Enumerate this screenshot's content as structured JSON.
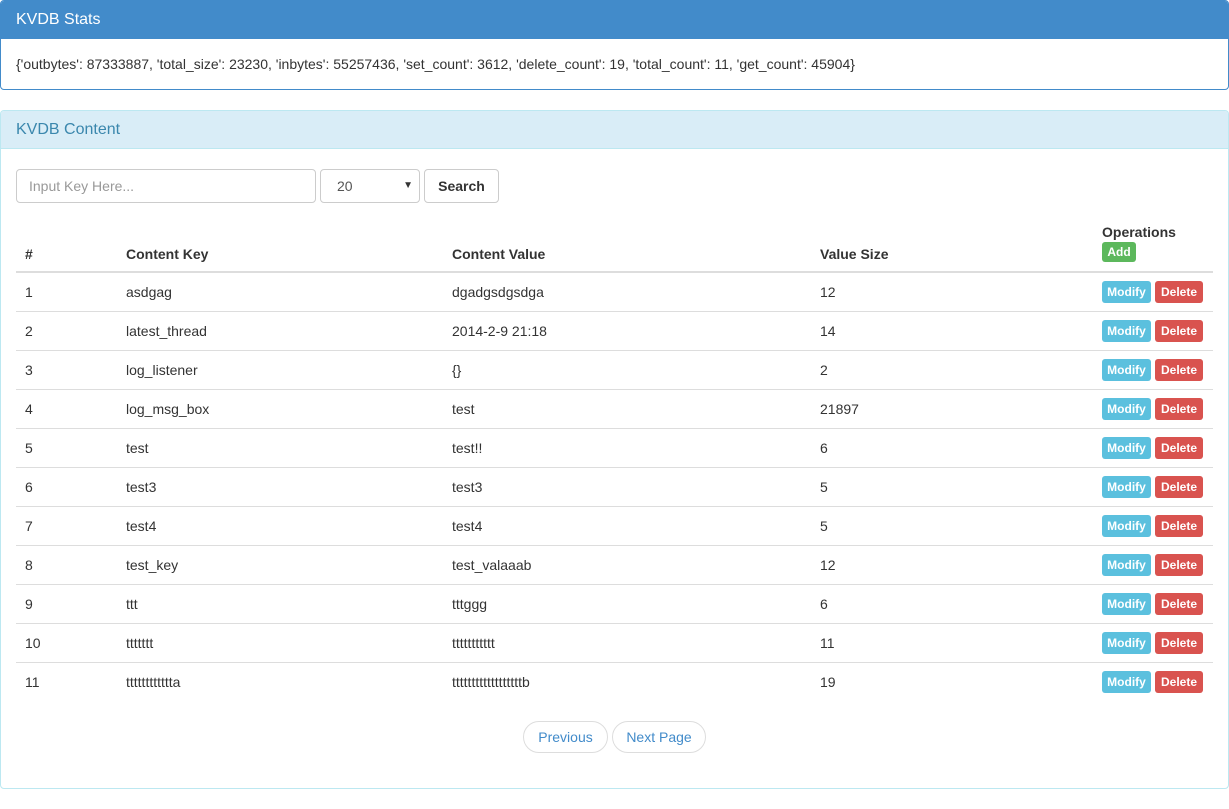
{
  "stats": {
    "title": "KVDB Stats",
    "body": "{'outbytes': 87333887, 'total_size': 23230, 'inbytes': 55257436, 'set_count': 3612, 'delete_count': 19, 'total_count': 11, 'get_count': 45904}"
  },
  "content": {
    "title": "KVDB Content",
    "search_placeholder": "Input Key Here...",
    "page_size": "20",
    "search_label": "Search",
    "headers": {
      "num": "#",
      "key": "Content Key",
      "value": "Content Value",
      "size": "Value Size",
      "ops": "Operations"
    },
    "add_label": "Add",
    "modify_label": "Modify",
    "delete_label": "Delete",
    "rows": [
      {
        "num": "1",
        "key": "asdgag",
        "value": "dgadgsdgsdga",
        "size": "12"
      },
      {
        "num": "2",
        "key": "latest_thread",
        "value": "2014-2-9 21:18",
        "size": "14"
      },
      {
        "num": "3",
        "key": "log_listener",
        "value": "{}",
        "size": "2"
      },
      {
        "num": "4",
        "key": "log_msg_box",
        "value": "test",
        "size": "21897"
      },
      {
        "num": "5",
        "key": "test",
        "value": "test!!",
        "size": "6"
      },
      {
        "num": "6",
        "key": "test3",
        "value": "test3",
        "size": "5"
      },
      {
        "num": "7",
        "key": "test4",
        "value": "test4",
        "size": "5"
      },
      {
        "num": "8",
        "key": "test_key",
        "value": "test_valaaab",
        "size": "12"
      },
      {
        "num": "9",
        "key": "ttt",
        "value": "tttggg",
        "size": "6"
      },
      {
        "num": "10",
        "key": "ttttttt",
        "value": "ttttttttttt",
        "size": "11"
      },
      {
        "num": "11",
        "key": "tttttttttttta",
        "value": "ttttttttttttttttttb",
        "size": "19"
      }
    ],
    "pager": {
      "previous": "Previous",
      "next": "Next Page"
    }
  }
}
